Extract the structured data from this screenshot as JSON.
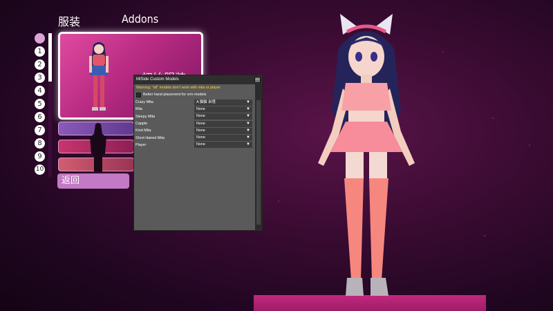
{
  "header": {
    "outfit_tab": "服装",
    "addons_tab": "Addons"
  },
  "number_list": [
    "1",
    "2",
    "3",
    "4",
    "5",
    "6",
    "7",
    "8",
    "9",
    "10"
  ],
  "outfit_card": {
    "title": "初始服装"
  },
  "back_button": "返回",
  "mod_window": {
    "title": "MiSide Custom Models",
    "close": "—",
    "warning": "Warning: \"all\" models don't work with mila or player",
    "toggle_label": "Better hand placement for vrm models",
    "rows": [
      {
        "name": "Crazy Mita",
        "value": "A 猫猫 米塔"
      },
      {
        "name": "Mila",
        "value": "None"
      },
      {
        "name": "Sleepy Mita",
        "value": "None"
      },
      {
        "name": "Cappie",
        "value": "None"
      },
      {
        "name": "Kind Mita",
        "value": "None"
      },
      {
        "name": "Short Haired Mita",
        "value": "None"
      },
      {
        "name": "Player",
        "value": "None"
      }
    ],
    "dropdown_arrow": "▼"
  },
  "colors": {
    "background": "#3a0b32",
    "accent": "#c3287e",
    "warning": "#ffd43b"
  }
}
